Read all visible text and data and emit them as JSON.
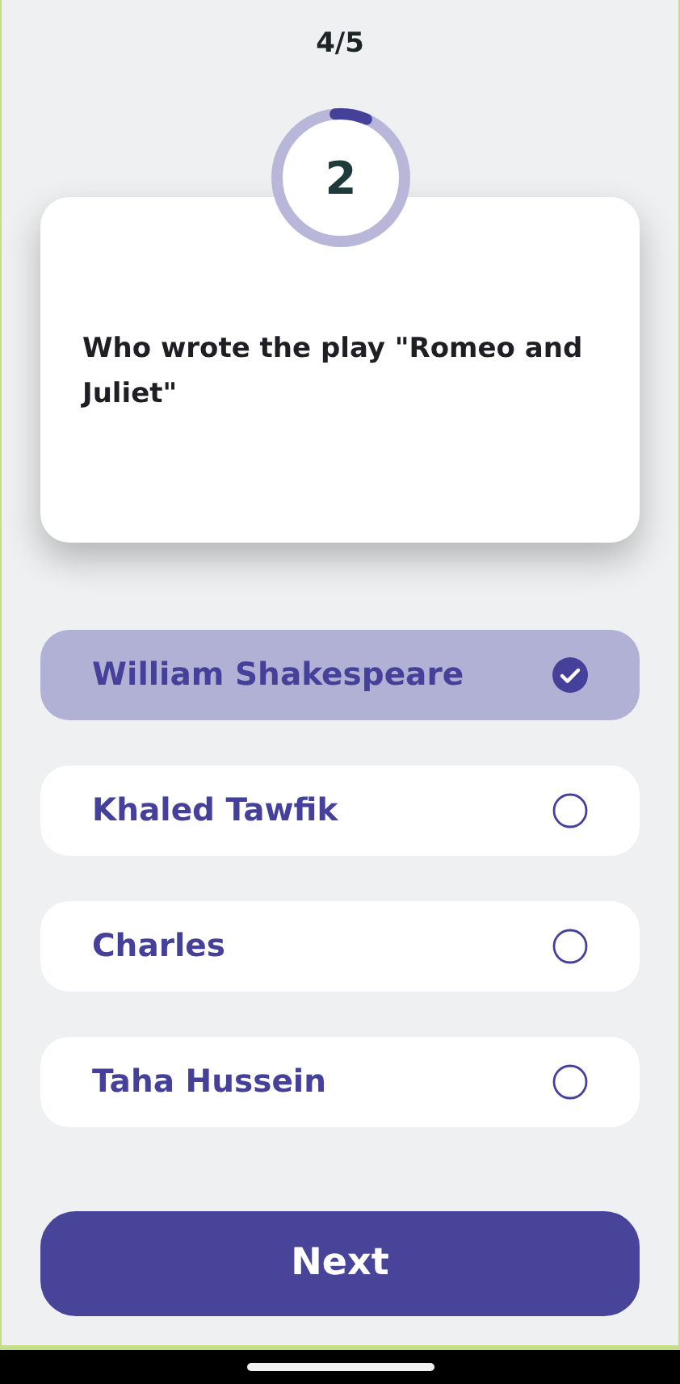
{
  "progress": "4/5",
  "timer": {
    "seconds": "2",
    "level": 0.08
  },
  "question": "Who wrote the play \"Romeo and Juliet\"",
  "answers": [
    {
      "label": "William Shakespeare",
      "selected": true
    },
    {
      "label": "Khaled Tawfik",
      "selected": false
    },
    {
      "label": "Charles",
      "selected": false
    },
    {
      "label": "Taha Hussein",
      "selected": false
    }
  ],
  "next_button": "Next"
}
